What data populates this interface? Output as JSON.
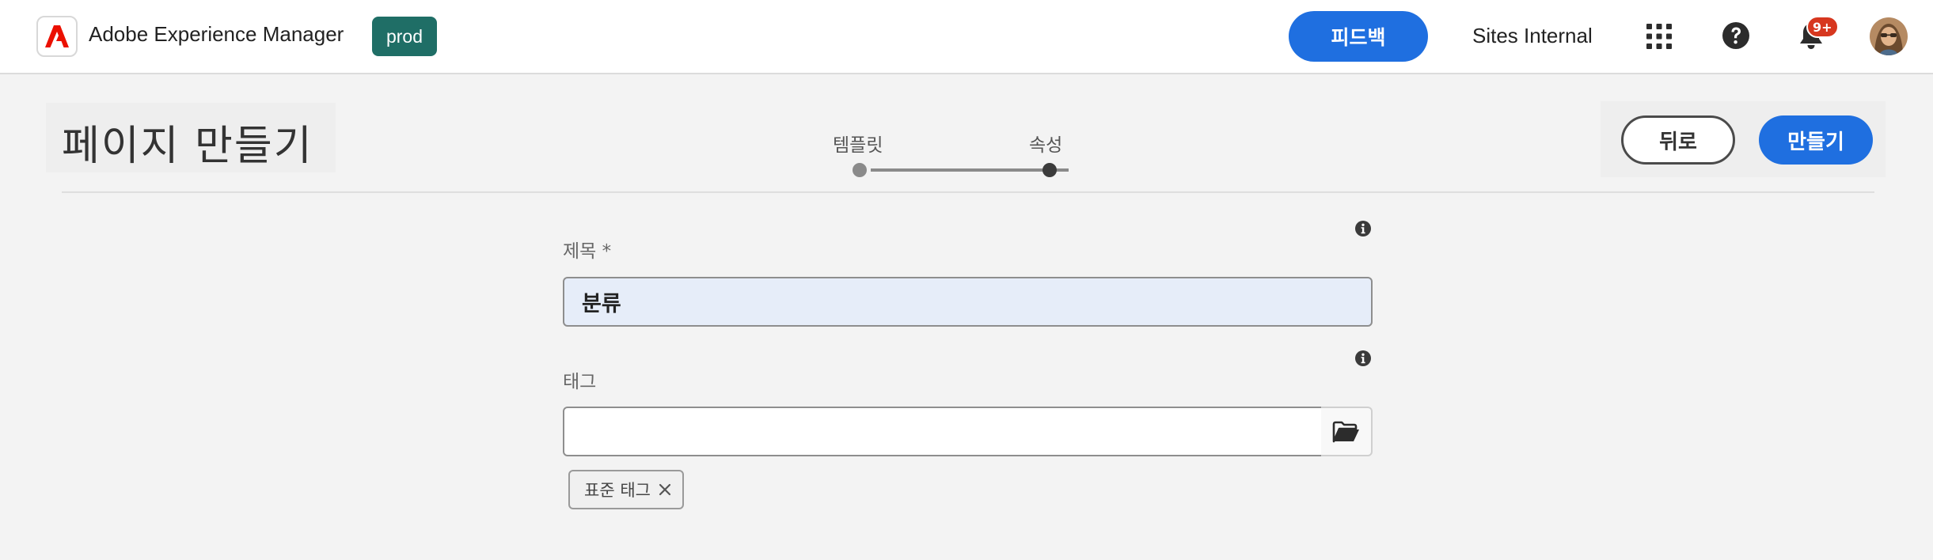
{
  "header": {
    "app_title": "Adobe Experience Manager",
    "env_badge": "prod",
    "feedback_label": "피드백",
    "org_name": "Sites Internal",
    "notification_count": "9+",
    "icons": [
      "adobe-logo-icon",
      "apps-grid-icon",
      "help-icon",
      "bell-icon",
      "avatar"
    ],
    "colors": {
      "primary": "#1f6fe0",
      "env_badge": "#1f6e66",
      "adobe_red": "#eb1000",
      "notif": "#d7371f"
    }
  },
  "page": {
    "title": "페이지 만들기",
    "wizard": {
      "steps": [
        {
          "label": "템플릿",
          "state": "done"
        },
        {
          "label": "속성",
          "state": "current"
        }
      ]
    },
    "actions": {
      "back_label": "뒤로",
      "create_label": "만들기"
    }
  },
  "form": {
    "title_field": {
      "label": "제목 *",
      "value": "분류"
    },
    "tags_field": {
      "label": "태그",
      "value": "",
      "chips": [
        {
          "label": "표준 태그"
        }
      ]
    }
  }
}
